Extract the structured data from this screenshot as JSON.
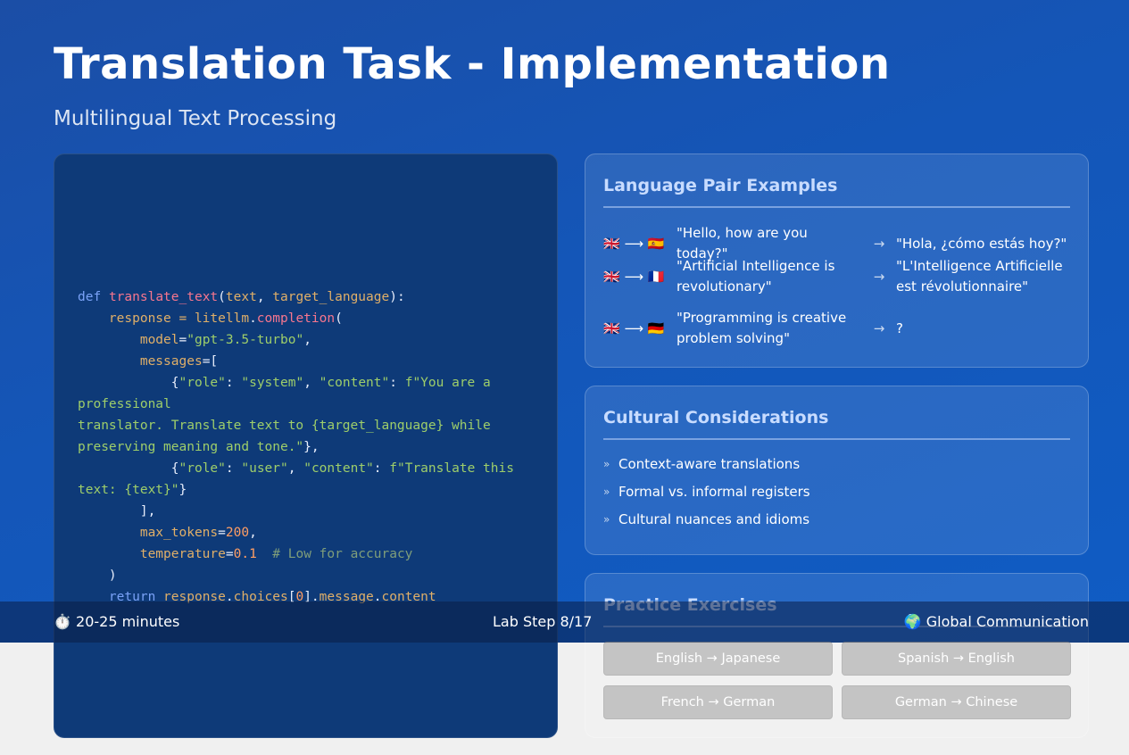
{
  "title": "Translation Task - Implementation",
  "subtitle": "Multilingual Text Processing",
  "code": {
    "l1": [
      "def",
      "translate_text",
      "(",
      "text",
      ", ",
      "target_language",
      "):"
    ],
    "l2": [
      "    response = ",
      "litellm",
      ".",
      "completion",
      "("
    ],
    "l3": [
      "        ",
      "model",
      "=",
      "\"gpt-3.5-turbo\"",
      ","
    ],
    "l4": [
      "        ",
      "messages",
      "=["
    ],
    "l5": [
      "            {",
      "\"role\"",
      ": ",
      "\"system\"",
      ", ",
      "\"content\"",
      ": ",
      "f\"You are a"
    ],
    "l6": "professional",
    "l7": "translator. Translate text to {target_language} while",
    "l8": [
      "preserving meaning and tone.\"",
      "},"
    ],
    "l9": [
      "            {",
      "\"role\"",
      ": ",
      "\"user\"",
      ", ",
      "\"content\"",
      ": ",
      "f\"Translate this"
    ],
    "l10": [
      "text: {text}\"",
      "}"
    ],
    "l11": "        ],",
    "l12": [
      "        ",
      "max_tokens",
      "=",
      "200",
      ","
    ],
    "l13": [
      "        ",
      "temperature",
      "=",
      "0.1",
      "  ",
      "# Low for accuracy"
    ],
    "l14": "    )",
    "l15": [
      "    ",
      "return",
      " ",
      "response",
      ".",
      "choices",
      "[",
      "0",
      "].",
      "message",
      ".",
      "content"
    ]
  },
  "language_pairs": {
    "heading": "Language Pair Examples",
    "arrow": "→",
    "items": [
      {
        "flags": "🇬🇧 ⟶ 🇪🇸",
        "source": "\"Hello, how are you today?\"",
        "target": "\"Hola, ¿cómo estás hoy?\""
      },
      {
        "flags": "🇬🇧 ⟶ 🇫🇷",
        "source": "\"Artificial Intelligence is revolutionary\"",
        "target": "\"L'Intelligence Artificielle est révolutionnaire\""
      },
      {
        "flags": "🇬🇧 ⟶ 🇩🇪",
        "source": "\"Programming is creative problem solving\"",
        "target": "?"
      }
    ]
  },
  "cultural": {
    "heading": "Cultural Considerations",
    "bullet": "»",
    "items": [
      "Context-aware translations",
      "Formal vs. informal registers",
      "Cultural nuances and idioms"
    ]
  },
  "practice": {
    "heading": "Practice Exercises",
    "exercises": [
      "English → Japanese",
      "Spanish → English",
      "French → German",
      "German → Chinese"
    ]
  },
  "footer": {
    "duration": "⏱️ 20-25 minutes",
    "step": "Lab Step 8/17",
    "theme": "🌍 Global Communication"
  },
  "colors": {
    "background": "#1456b8",
    "code_bg": "#0e3a78",
    "heading": "#c8dcff",
    "exercise_button": "#c4c4c4"
  }
}
